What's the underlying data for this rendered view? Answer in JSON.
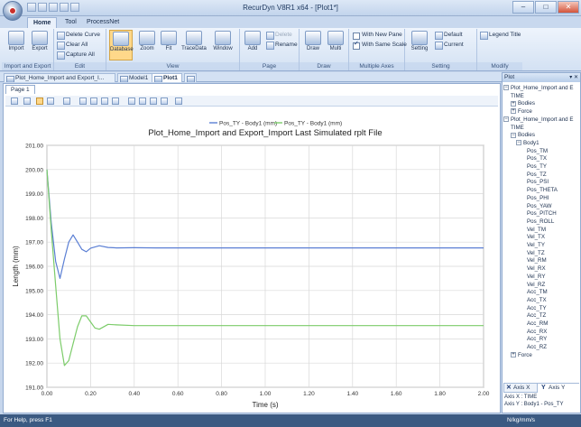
{
  "window": {
    "title": "RecurDyn V8R1 x64 - [Plot1*]",
    "controls": [
      "–",
      "□",
      "✕"
    ]
  },
  "ribbon_tabs": [
    "Home",
    "Tool",
    "ProcessNet"
  ],
  "ribbon": {
    "import_export": {
      "label": "Import and Export",
      "import": "Import",
      "export": "Export"
    },
    "edit": {
      "label": "Edit",
      "delete_curve": "Delete Curve",
      "clear_all": "Clear All",
      "capture_all": "Capture All"
    },
    "view": {
      "label": "View",
      "database": "Database",
      "zoom": "Zoom",
      "fit": "Fit",
      "trace_data": "TraceData",
      "window": "Window"
    },
    "page": {
      "label": "Page",
      "add": "Add",
      "delete": "Delete",
      "rename": "Rename"
    },
    "draw": {
      "label": "Draw",
      "draw": "Draw",
      "multi": "Multi"
    },
    "multiple_axes": {
      "label": "Multiple Axes",
      "with_new_pane": "With New Pane",
      "with_same_scale": "With Same Scale"
    },
    "setting": {
      "label": "Setting",
      "setting": "Setting",
      "default": "Default",
      "current": "Current"
    },
    "modify": {
      "label": "Modify",
      "legend_title": "Legend Title"
    }
  },
  "doc_tabs": [
    "Plot_Home_Import and Export_I...",
    "Model1",
    "Plot1"
  ],
  "page_tab": "Page 1",
  "panel": {
    "title": "Plot",
    "tree": [
      {
        "label": "Plot_Home_Import and E",
        "exp": "⊟"
      },
      {
        "label": "TIME"
      },
      {
        "label": "Bodies",
        "exp": "⊞"
      },
      {
        "label": "Force",
        "exp": "⊞"
      },
      {
        "label": "Plot_Home_Import and E",
        "exp": "⊟"
      },
      {
        "label": "TIME"
      },
      {
        "label": "Bodies",
        "exp": "⊟"
      },
      {
        "label": "Body1",
        "exp": "⊟"
      },
      {
        "label": "Pos_TM"
      },
      {
        "label": "Pos_TX"
      },
      {
        "label": "Pos_TY"
      },
      {
        "label": "Pos_TZ"
      },
      {
        "label": "Pos_PSI"
      },
      {
        "label": "Pos_THETA"
      },
      {
        "label": "Pos_PHI"
      },
      {
        "label": "Pos_YAW"
      },
      {
        "label": "Pos_PITCH"
      },
      {
        "label": "Pos_ROLL"
      },
      {
        "label": "Vel_TM"
      },
      {
        "label": "Vel_TX"
      },
      {
        "label": "Vel_TY"
      },
      {
        "label": "Vel_TZ"
      },
      {
        "label": "Vel_RM"
      },
      {
        "label": "Vel_RX"
      },
      {
        "label": "Vel_RY"
      },
      {
        "label": "Vel_RZ"
      },
      {
        "label": "Acc_TM"
      },
      {
        "label": "Acc_TX"
      },
      {
        "label": "Acc_TY"
      },
      {
        "label": "Acc_TZ"
      },
      {
        "label": "Acc_RM"
      },
      {
        "label": "Acc_RX"
      },
      {
        "label": "Acc_RY"
      },
      {
        "label": "Acc_RZ"
      },
      {
        "label": "Force",
        "exp": "⊞"
      }
    ],
    "axis_tabs": [
      "Axis X",
      "Axis Y"
    ],
    "axis_x_info": "Axis X : TIME",
    "axis_y_info": "Axis Y : Body1 - Pos_TY"
  },
  "status": {
    "left": "For Help, press F1",
    "right": "N/kg/mm/s"
  },
  "chart_data": {
    "type": "line",
    "title": "Plot_Home_Import and Export_Import Last Simulated rplt File",
    "xlabel": "Time (s)",
    "ylabel": "Length (mm)",
    "xlim": [
      0,
      2.0
    ],
    "ylim": [
      191.0,
      201.0
    ],
    "xticks": [
      "0.00",
      "0.20",
      "0.40",
      "0.60",
      "0.80",
      "1.00",
      "1.20",
      "1.40",
      "1.60",
      "1.80",
      "2.00"
    ],
    "yticks": [
      "191.00",
      "192.00",
      "193.00",
      "194.00",
      "195.00",
      "196.00",
      "197.00",
      "198.00",
      "199.00",
      "200.00",
      "201.00"
    ],
    "grid": true,
    "legend_position": "top-center",
    "series": [
      {
        "name": "Pos_TY - Body1 (mm)",
        "color": "#5b7fd4",
        "x": [
          0,
          0.02,
          0.04,
          0.06,
          0.08,
          0.1,
          0.12,
          0.14,
          0.16,
          0.18,
          0.2,
          0.24,
          0.28,
          0.32,
          0.4,
          0.5,
          0.6,
          0.8,
          1.0,
          1.5,
          2.0
        ],
        "y": [
          200.0,
          197.8,
          196.2,
          195.5,
          196.3,
          197.0,
          197.3,
          197.0,
          196.7,
          196.6,
          196.75,
          196.85,
          196.78,
          196.76,
          196.77,
          196.76,
          196.76,
          196.76,
          196.76,
          196.76,
          196.76
        ]
      },
      {
        "name": "Pos_TY - Body1 (mm)",
        "color": "#7ccc6a",
        "x": [
          0,
          0.02,
          0.04,
          0.06,
          0.08,
          0.1,
          0.12,
          0.14,
          0.16,
          0.18,
          0.2,
          0.22,
          0.24,
          0.28,
          0.32,
          0.4,
          0.5,
          0.6,
          0.8,
          1.0,
          1.5,
          2.0
        ],
        "y": [
          200.0,
          197.5,
          195.2,
          193.0,
          191.9,
          192.1,
          192.8,
          193.5,
          193.95,
          193.95,
          193.7,
          193.45,
          193.4,
          193.6,
          193.58,
          193.55,
          193.55,
          193.55,
          193.55,
          193.55,
          193.55,
          193.55
        ]
      }
    ]
  }
}
